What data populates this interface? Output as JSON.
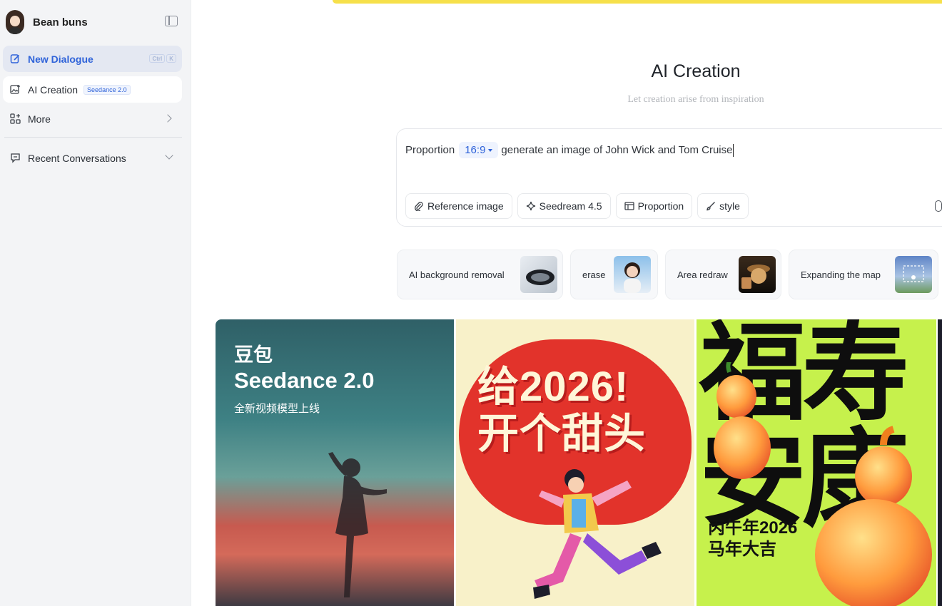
{
  "sidebar": {
    "user_name": "Bean buns",
    "new_dialogue": {
      "label": "New Dialogue",
      "shortcut": [
        "Ctrl",
        "K"
      ]
    },
    "ai_creation": {
      "label": "AI Creation",
      "badge": "Seedance 2.0"
    },
    "more": {
      "label": "More"
    },
    "recent": {
      "label": "Recent Conversations"
    }
  },
  "main": {
    "title": "AI Creation",
    "subtitle": "Let creation arise from inspiration",
    "prompt": {
      "prefix": "Proportion",
      "ratio": "16:9",
      "text": "generate an image of John Wick and Tom Cruise"
    },
    "tools": [
      {
        "label": "Reference image",
        "icon": "paperclip-icon"
      },
      {
        "label": "Seedream 4.5",
        "icon": "sparkle-icon"
      },
      {
        "label": "Proportion",
        "icon": "layout-icon"
      },
      {
        "label": "style",
        "icon": "brush-icon"
      }
    ],
    "features": [
      {
        "label": "AI background removal"
      },
      {
        "label": "erase"
      },
      {
        "label": "Area redraw"
      },
      {
        "label": "Expanding the map"
      }
    ],
    "gallery": {
      "card1": {
        "brand": "豆包",
        "model": "Seedance 2.0",
        "tagline": "全新视频模型上线"
      },
      "card2": {
        "line1": "给2026!",
        "line2": "开个甜头"
      },
      "card3": {
        "big1": "福寿",
        "big2": "安康",
        "small1": "丙午年2026",
        "small2": "马年大吉"
      }
    }
  },
  "colors": {
    "accent": "#2f63d9",
    "top_bar": "#f6e04a",
    "sidebar_bg": "#f3f4f6"
  }
}
